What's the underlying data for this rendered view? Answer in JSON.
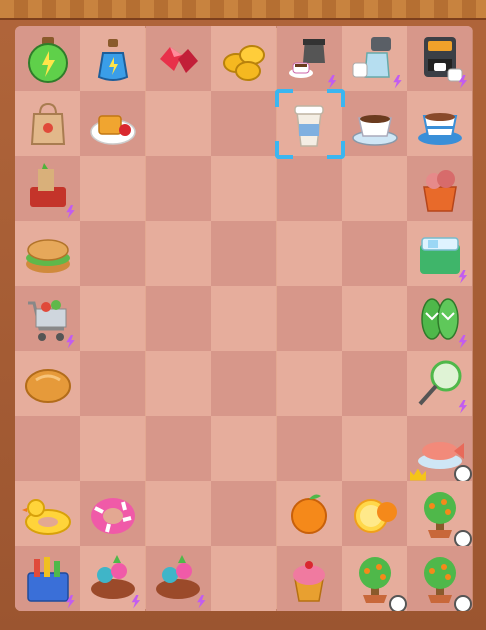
{
  "game": {
    "grid": {
      "columns": 7,
      "rows": 9
    },
    "selected_cell": {
      "row": 1,
      "col": 4
    },
    "items": [
      {
        "row": 0,
        "col": 0,
        "icon": "green-potion-icon"
      },
      {
        "row": 0,
        "col": 1,
        "icon": "blue-potion-icon"
      },
      {
        "row": 0,
        "col": 2,
        "icon": "red-gems-icon"
      },
      {
        "row": 0,
        "col": 3,
        "icon": "gold-coins-icon"
      },
      {
        "row": 0,
        "col": 4,
        "icon": "coffee-pot-cup-icon",
        "bolt": true
      },
      {
        "row": 0,
        "col": 5,
        "icon": "coffee-maker-glass-icon",
        "bolt": true
      },
      {
        "row": 0,
        "col": 6,
        "icon": "espresso-machine-icon",
        "bolt": true
      },
      {
        "row": 1,
        "col": 0,
        "icon": "paper-bag-icon"
      },
      {
        "row": 1,
        "col": 1,
        "icon": "waffle-plate-icon"
      },
      {
        "row": 1,
        "col": 4,
        "icon": "takeaway-coffee-cup-icon"
      },
      {
        "row": 1,
        "col": 5,
        "icon": "coffee-cup-saucer-icon"
      },
      {
        "row": 1,
        "col": 6,
        "icon": "tea-cup-saucer-icon"
      },
      {
        "row": 2,
        "col": 0,
        "icon": "grocery-basket-icon",
        "bolt": true
      },
      {
        "row": 2,
        "col": 6,
        "icon": "meat-bucket-icon"
      },
      {
        "row": 3,
        "col": 0,
        "icon": "bagel-sandwich-icon"
      },
      {
        "row": 3,
        "col": 6,
        "icon": "ice-cooler-icon",
        "bolt": true
      },
      {
        "row": 4,
        "col": 0,
        "icon": "shopping-cart-icon",
        "bolt": true
      },
      {
        "row": 4,
        "col": 6,
        "icon": "flip-flops-icon",
        "bolt": true
      },
      {
        "row": 5,
        "col": 0,
        "icon": "bread-loaf-icon"
      },
      {
        "row": 5,
        "col": 6,
        "icon": "fishing-net-icon",
        "bolt": true
      },
      {
        "row": 6,
        "col": 6,
        "icon": "fish-platter-icon",
        "crown": true,
        "timer": true
      },
      {
        "row": 7,
        "col": 0,
        "icon": "rubber-duck-float-icon"
      },
      {
        "row": 7,
        "col": 1,
        "icon": "pink-swim-ring-icon"
      },
      {
        "row": 7,
        "col": 4,
        "icon": "orange-fruit-icon"
      },
      {
        "row": 7,
        "col": 5,
        "icon": "orange-slice-icon"
      },
      {
        "row": 7,
        "col": 6,
        "icon": "orange-tree-icon",
        "timer": true
      },
      {
        "row": 8,
        "col": 0,
        "icon": "toy-crate-icon",
        "bolt": true
      },
      {
        "row": 8,
        "col": 1,
        "icon": "candy-pile-icon",
        "bolt": true
      },
      {
        "row": 8,
        "col": 2,
        "icon": "candy-pile-icon",
        "bolt": true
      },
      {
        "row": 8,
        "col": 4,
        "icon": "cupcake-icon"
      },
      {
        "row": 8,
        "col": 5,
        "icon": "orange-tree-icon",
        "timer": true
      },
      {
        "row": 8,
        "col": 6,
        "icon": "orange-tree-icon",
        "timer": true
      }
    ]
  }
}
